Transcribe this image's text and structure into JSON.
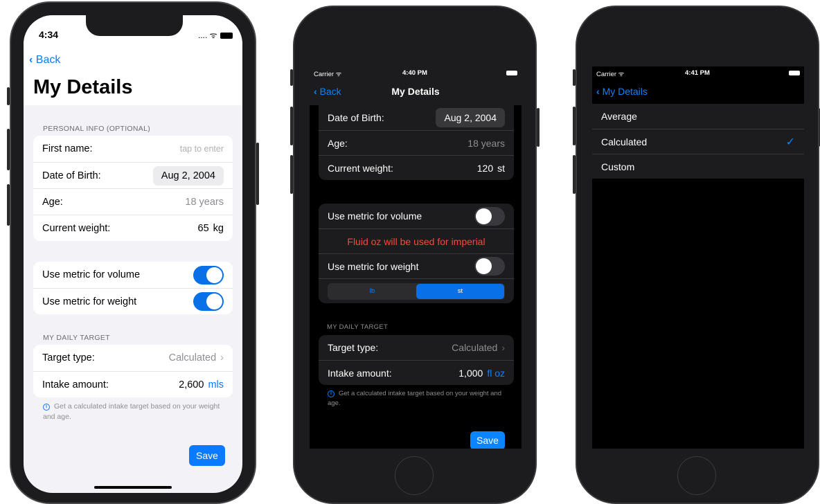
{
  "phone1": {
    "status_time": "4:34",
    "status_right": ".... ᯤ",
    "back_label": "Back",
    "title": "My Details",
    "section_personal": "PERSONAL INFO (OPTIONAL)",
    "first_name_label": "First name:",
    "first_name_placeholder": "tap to enter",
    "dob_label": "Date of Birth:",
    "dob_value": "Aug 2, 2004",
    "age_label": "Age:",
    "age_value": "18 years",
    "weight_label": "Current weight:",
    "weight_value": "65",
    "weight_unit": "kg",
    "metric_volume_label": "Use metric for volume",
    "metric_volume_on": true,
    "metric_weight_label": "Use metric for weight",
    "metric_weight_on": true,
    "section_target": "MY DAILY TARGET",
    "target_type_label": "Target type:",
    "target_type_value": "Calculated",
    "intake_label": "Intake amount:",
    "intake_value": "2,600",
    "intake_unit": "mls",
    "info_text": "Get a calculated intake target based on your weight and age.",
    "save_label": "Save"
  },
  "phone2": {
    "carrier": "Carrier ᯤ",
    "status_time": "4:40 PM",
    "back_label": "Back",
    "nav_title": "My Details",
    "dob_label": "Date of Birth:",
    "dob_value": "Aug 2, 2004",
    "age_label": "Age:",
    "age_value": "18 years",
    "weight_label": "Current weight:",
    "weight_value": "120",
    "weight_unit": "st",
    "metric_volume_label": "Use metric for volume",
    "metric_volume_on": false,
    "warning_text": "Fluid oz will be used for imperial",
    "metric_weight_label": "Use metric for weight",
    "metric_weight_on": false,
    "segment_options": [
      "lb",
      "st"
    ],
    "segment_selected": "st",
    "section_target": "MY DAILY TARGET",
    "target_type_label": "Target type:",
    "target_type_value": "Calculated",
    "intake_label": "Intake amount:",
    "intake_value": "1,000",
    "intake_unit": "fl oz",
    "info_text": "Get a calculated intake target based on your weight and age.",
    "save_label": "Save"
  },
  "phone3": {
    "carrier": "Carrier ᯤ",
    "status_time": "4:41 PM",
    "back_label": "My Details",
    "options": [
      "Average",
      "Calculated",
      "Custom"
    ],
    "selected": "Calculated"
  },
  "colors": {
    "accent": "#0a7aff",
    "warning": "#ff453a",
    "dark_bg": "#000000",
    "dark_cell": "#1c1c1e"
  }
}
